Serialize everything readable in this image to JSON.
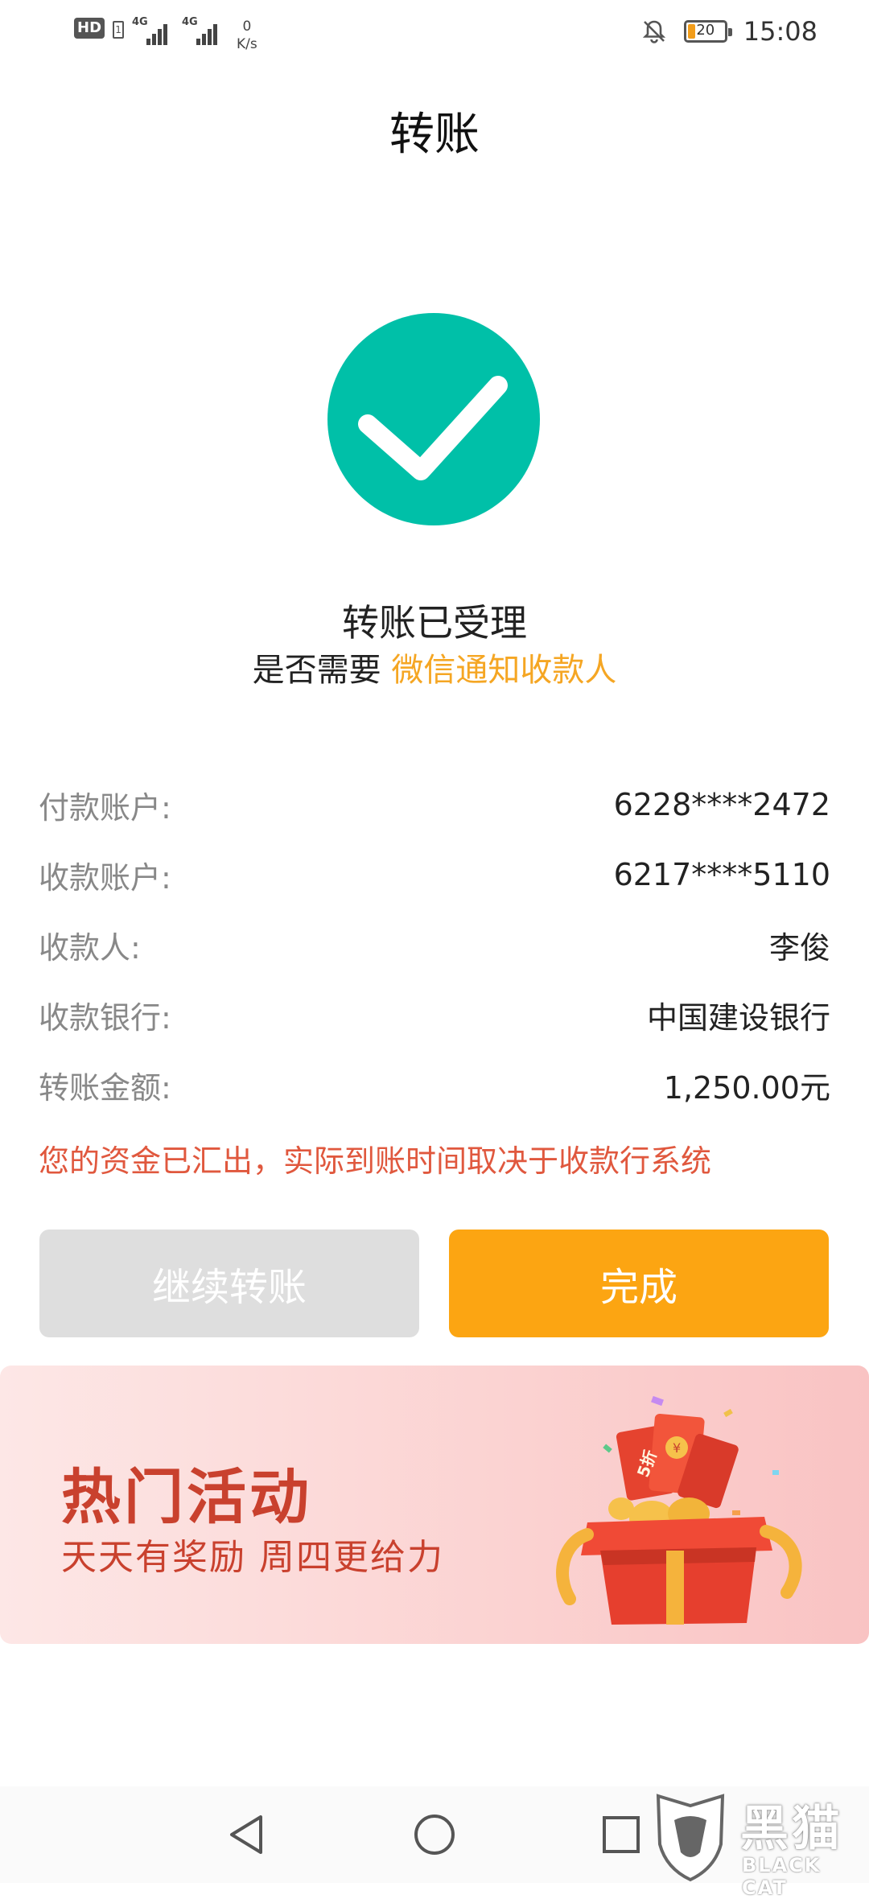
{
  "status_bar": {
    "hd_label": "HD",
    "sim_label": "1",
    "network_1": "4G",
    "network_2": "4G",
    "speed_value": "0",
    "speed_unit": "K/s",
    "battery_level": "20",
    "time": "15:08",
    "icons": [
      "hd-icon",
      "signal-icon",
      "signal-icon",
      "bell-off-icon",
      "battery-icon"
    ]
  },
  "header": {
    "title": "转账"
  },
  "result": {
    "icon": "check-circle-icon",
    "icon_color": "#00c0a8",
    "title": "转账已受理",
    "notify_prefix": "是否需要 ",
    "notify_link": "微信通知收款人"
  },
  "details": [
    {
      "label": "付款账户:",
      "value": "6228****2472"
    },
    {
      "label": "收款账户:",
      "value": "6217****5110"
    },
    {
      "label": "收款人:",
      "value": "李俊"
    },
    {
      "label": "收款银行:",
      "value": "中国建设银行"
    },
    {
      "label": "转账金额:",
      "value": "1,250.00元"
    }
  ],
  "notice": "您的资金已汇出，实际到账时间取决于收款行系统",
  "buttons": {
    "continue_label": "继续转账",
    "done_label": "完成"
  },
  "banner": {
    "title": "热门活动",
    "subtitle": "天天有奖励  周四更给力",
    "art_icon": "gift-box-icon",
    "coin_text": "¥",
    "envelope_text": "5折"
  },
  "nav": {
    "icons": [
      "back-triangle-icon",
      "home-circle-icon",
      "recent-square-icon"
    ]
  },
  "watermark": {
    "cn": "黑猫",
    "en": "BLACK CAT"
  },
  "colors": {
    "accent": "#fca512",
    "link": "#f5a623",
    "notice": "#e0583e",
    "success": "#00c0a8"
  }
}
